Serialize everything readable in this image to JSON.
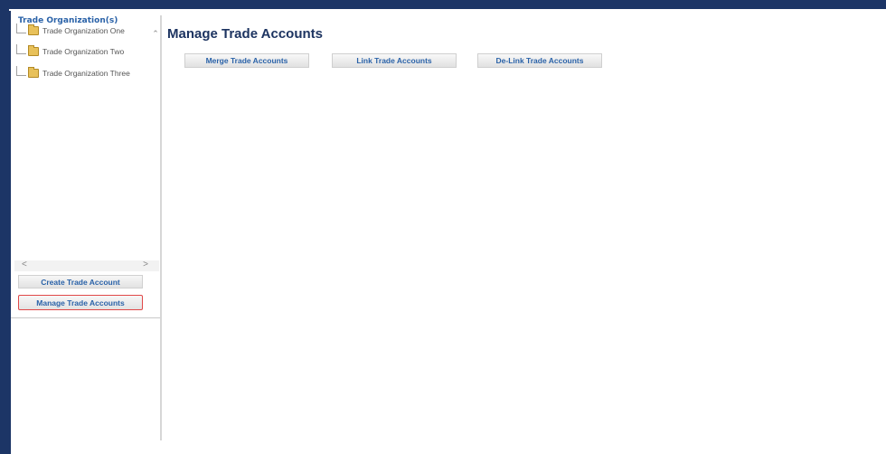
{
  "tree": {
    "title": "Trade Organization(s)",
    "items": [
      {
        "label": "Trade Organization One"
      },
      {
        "label": "Trade Organization Two"
      },
      {
        "label": "Trade Organization Three"
      }
    ]
  },
  "scroll": {
    "up": "⌃",
    "down": "⌄",
    "left": "<",
    "right": ">"
  },
  "sidebar_buttons": {
    "create": "Create Trade Account",
    "manage": "Manage Trade Accounts"
  },
  "main": {
    "title": "Manage Trade Accounts",
    "buttons": {
      "merge": "Merge Trade Accounts",
      "link": "Link Trade Accounts",
      "delink": "De-Link Trade Accounts"
    }
  },
  "colors": {
    "frame": "#1c3566",
    "accent_text": "#2a62a8",
    "selected_border": "#e04848",
    "title": "#1d3461"
  }
}
